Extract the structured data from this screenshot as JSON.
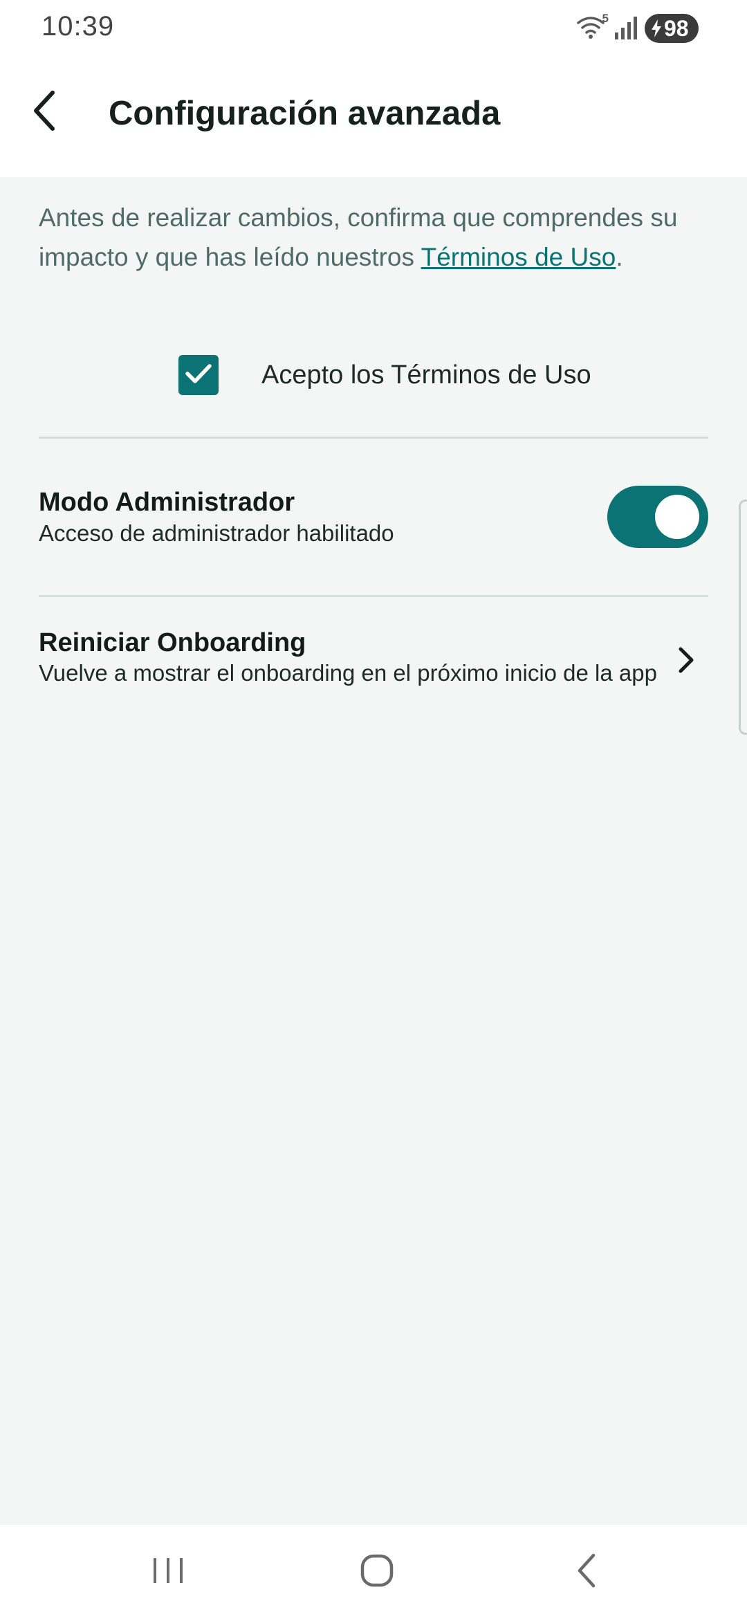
{
  "status_bar": {
    "time": "10:39",
    "wifi_label": "5",
    "battery_level": "98",
    "icons": [
      "wifi-icon",
      "signal-icon",
      "charging-bolt-icon"
    ]
  },
  "header": {
    "title": "Configuración avanzada",
    "back_icon": "chevron-left-icon"
  },
  "terms": {
    "intro_text": "Antes de realizar cambios, confirma que comprendes su impacto y que has leído nuestros ",
    "link_text": "Términos de Uso",
    "trailing": ".",
    "checkbox_label": "Acepto los Términos de Uso",
    "checked": true
  },
  "settings": {
    "admin": {
      "title": "Modo Administrador",
      "subtitle": "Acceso de administrador habilitado",
      "enabled": true
    },
    "onboarding": {
      "title": "Reiniciar Onboarding",
      "subtitle": "Vuelve a mostrar el onboarding en el próximo inicio de la app"
    }
  },
  "navigation": {
    "buttons": [
      "recent-apps-icon",
      "home-icon",
      "back-icon"
    ]
  },
  "colors": {
    "accent": "#0b7373",
    "background": "#f4f6f5",
    "surface": "#ffffff",
    "text_primary": "#141c1a",
    "text_secondary": "#4f6b66"
  }
}
